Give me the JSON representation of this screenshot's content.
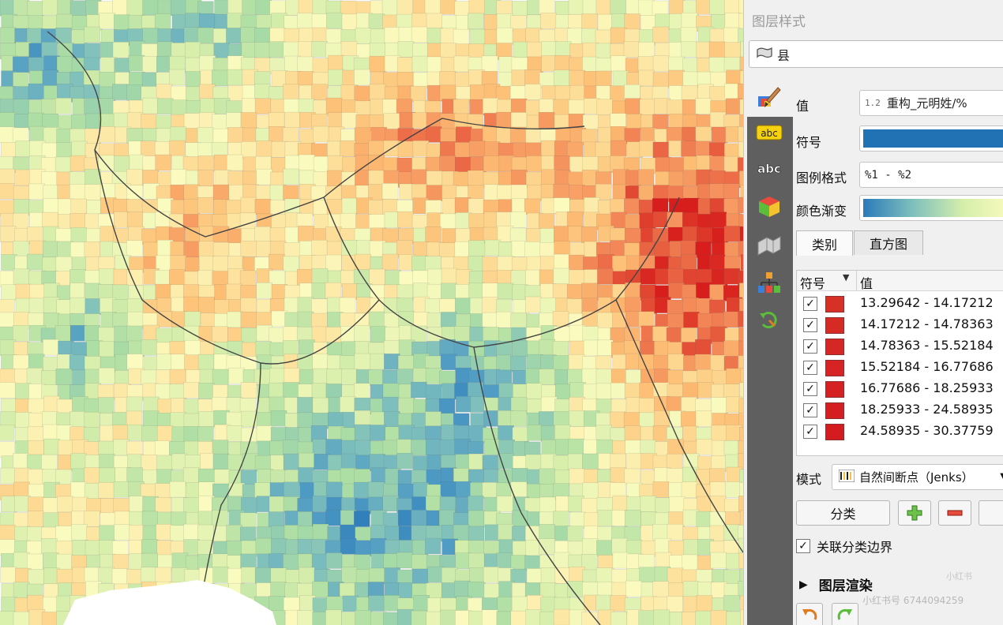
{
  "map": {
    "description_colors": {
      "low": "#2b7bba",
      "mid": "#fbfbbf",
      "high": "#d7191c"
    }
  },
  "panel": {
    "title": "图层样式",
    "layer_name": "县",
    "value_label": "值",
    "value_prefix": "1.2",
    "value_expression": "重构_元明姓/%",
    "symbol_label": "符号",
    "symbol_color": "#2171b5",
    "legend_format_label": "图例格式",
    "legend_format_value": "%1 - %2",
    "color_ramp_label": "颜色渐变",
    "tabs": [
      {
        "label": "类别",
        "active": true
      },
      {
        "label": "直方图",
        "active": false
      }
    ],
    "table": {
      "col_symbol": "符号",
      "col_value": "值",
      "rows": [
        {
          "checked": true,
          "color": "#d73027",
          "range": "13.29642 - 14.17212"
        },
        {
          "checked": true,
          "color": "#d62b25",
          "range": "14.17212 - 14.78363"
        },
        {
          "checked": true,
          "color": "#d52724",
          "range": "14.78363 - 15.52184"
        },
        {
          "checked": true,
          "color": "#d52423",
          "range": "15.52184 - 16.77686"
        },
        {
          "checked": true,
          "color": "#d42122",
          "range": "16.77686 - 18.25933"
        },
        {
          "checked": true,
          "color": "#d41e21",
          "range": "18.25933 - 24.58935"
        },
        {
          "checked": true,
          "color": "#d41b20",
          "range": "24.58935 - 30.37759"
        }
      ]
    },
    "mode_label": "模式",
    "mode_value": "自然间断点（Jenks）",
    "classify_button": "分类",
    "link_boundaries_label": "关联分类边界",
    "layer_rendering_label": "图层渲染",
    "watermark_text": "小红书号 6744094259",
    "watermark_logo": "小红书"
  },
  "icons": {
    "layer": "polygon-icon",
    "toolbar": [
      "paintbrush-icon",
      "label-abc-yellow-icon",
      "label-abc-icon",
      "3d-cube-icon",
      "3d-map-icon",
      "diagram-icon",
      "history-icon"
    ],
    "add": "plus-icon",
    "remove": "minus-icon",
    "undo": "undo-icon",
    "redo": "redo-icon"
  }
}
